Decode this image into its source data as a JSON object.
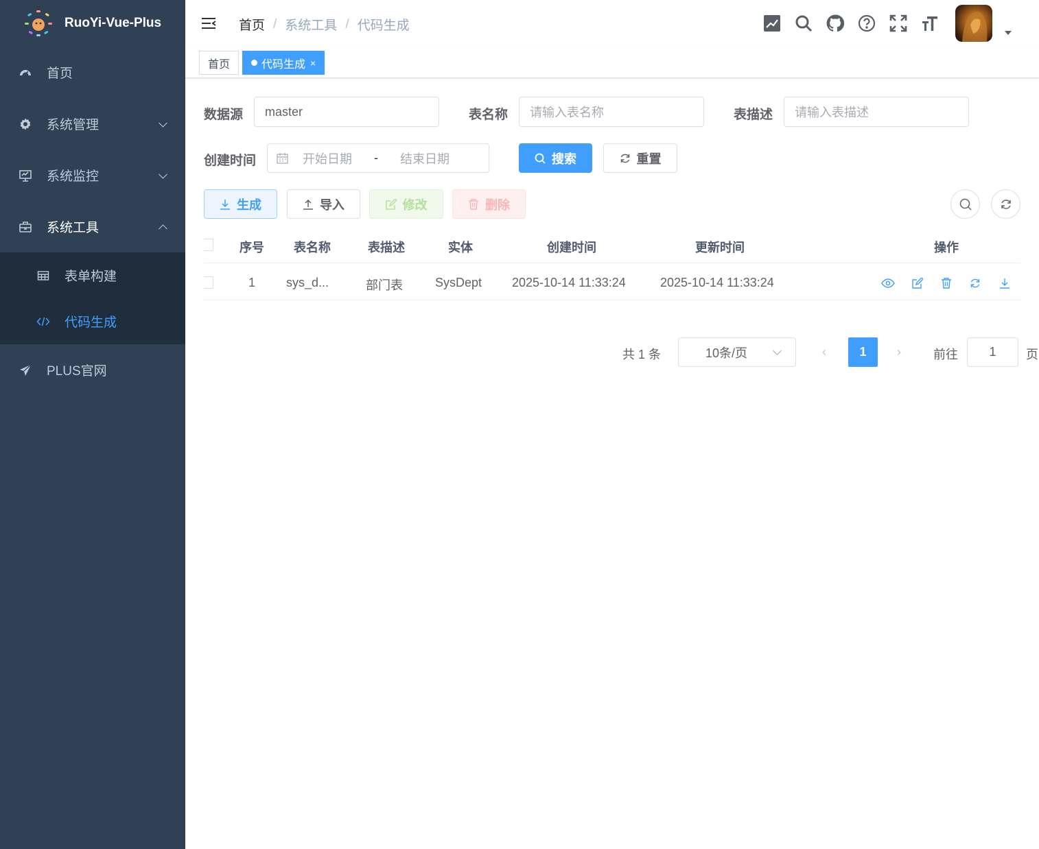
{
  "app": {
    "title": "RuoYi-Vue-Plus"
  },
  "sidebar": {
    "items": [
      {
        "label": "首页",
        "icon": "dashboard-icon"
      },
      {
        "label": "系统管理",
        "icon": "gear-icon"
      },
      {
        "label": "系统监控",
        "icon": "monitor-icon"
      },
      {
        "label": "系统工具",
        "icon": "toolbox-icon"
      },
      {
        "label": "PLUS官网",
        "icon": "send-icon"
      }
    ],
    "tool_children": [
      {
        "label": "表单构建",
        "icon": "table-icon"
      },
      {
        "label": "代码生成",
        "icon": "code-icon"
      }
    ]
  },
  "breadcrumb": [
    "首页",
    "系统工具",
    "代码生成"
  ],
  "breadcrumb_sep": "/",
  "tags": [
    {
      "label": "首页"
    },
    {
      "label": "代码生成",
      "close": "×"
    }
  ],
  "search": {
    "datasource_label": "数据源",
    "datasource_value": "master",
    "table_name_label": "表名称",
    "table_name_placeholder": "请输入表名称",
    "table_desc_label": "表描述",
    "table_desc_placeholder": "请输入表描述",
    "create_time_label": "创建时间",
    "start_placeholder": "开始日期",
    "range_sep": "-",
    "end_placeholder": "结束日期",
    "search_btn": "搜索",
    "reset_btn": "重置"
  },
  "toolbar": {
    "generate": "生成",
    "import": "导入",
    "edit": "修改",
    "delete": "删除"
  },
  "table": {
    "headers": [
      "序号",
      "表名称",
      "表描述",
      "实体",
      "创建时间",
      "更新时间",
      "操作"
    ],
    "rows": [
      {
        "index": "1",
        "table_name": "sys_d...",
        "table_desc": "部门表",
        "entity": "SysDept",
        "created": "2025-10-14 11:33:24",
        "updated": "2025-10-14 11:33:24"
      }
    ]
  },
  "pagination": {
    "total": "共 1 条",
    "page_size": "10条/页",
    "prev": "‹",
    "next": "›",
    "current": "1",
    "goto_label": "前往",
    "goto_value": "1",
    "page_suffix": "页"
  },
  "colors": {
    "sidebar_bg": "#304156",
    "submenu_bg": "#1f2d3d",
    "primary": "#409eff"
  }
}
